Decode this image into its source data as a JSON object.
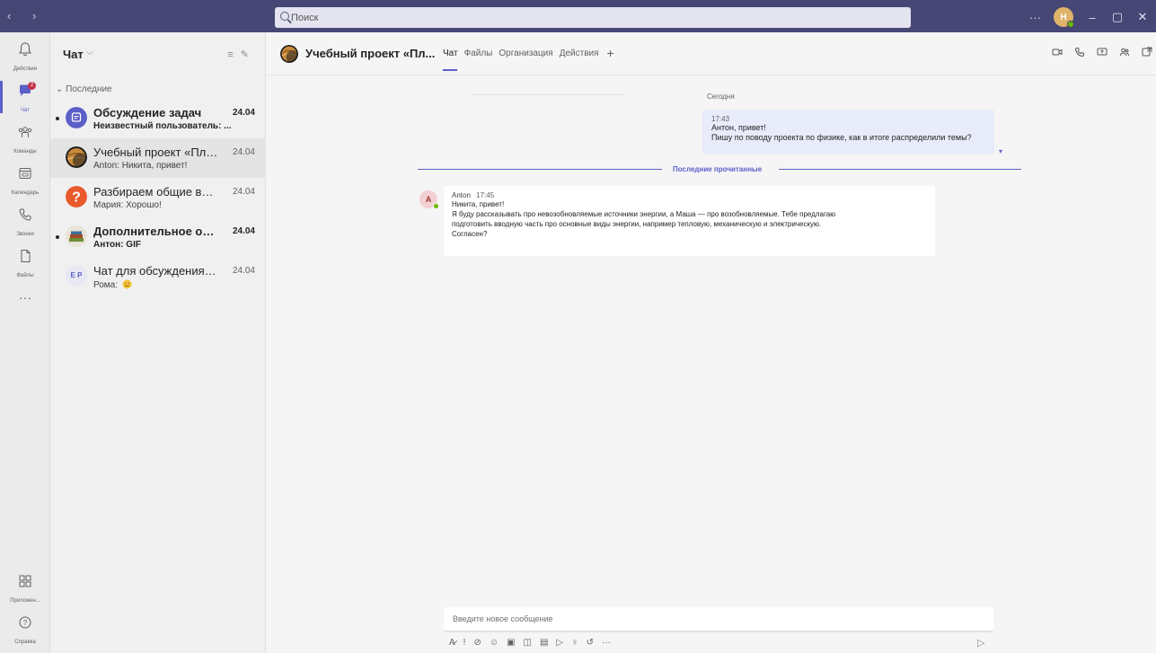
{
  "titlebar": {
    "nav": "‹ ›",
    "search_placeholder": "Поиск",
    "more": "···",
    "avatar_initials": "Н",
    "minimize": "–",
    "maximize": "▢",
    "close": "✕"
  },
  "rail": {
    "activity": "Действия",
    "chat": "Чат",
    "chat_badge": "2",
    "teams": "Команды",
    "calendar": "Календарь",
    "calls": "Звонки",
    "files": "Файлы",
    "more": "···",
    "apps": "Приложен...",
    "help": "Справка"
  },
  "chatlist": {
    "title": "Чат",
    "section": "Последние",
    "items": [
      {
        "name": "Обсуждение задач",
        "date": "24.04",
        "preview": "Неизвестный пользователь: ...",
        "unread": true
      },
      {
        "name": "Учебный проект «Плане...",
        "date": "24.04",
        "preview": "Anton: Никита, привет!",
        "unread": false
      },
      {
        "name": "Разбираем общие вопр...",
        "date": "24.04",
        "preview": "Мария: Хорошо!",
        "unread": false
      },
      {
        "name": "Дополнительное обра...",
        "date": "24.04",
        "preview": "Антон: GIF",
        "unread": true
      },
      {
        "name": "Чат для обсуждения зад...",
        "date": "24.04",
        "preview": "Рома:",
        "unread": false,
        "avatar_initials": "E P"
      }
    ]
  },
  "conversation": {
    "title": "Учебный проект «Пл...",
    "tabs": [
      "Чат",
      "Файлы",
      "Организация",
      "Действия"
    ],
    "day_separator": "Сегодня",
    "my_message": {
      "time": "17:43",
      "line1": "Антон, привет!",
      "line2": "Пишу по поводу проекта по физике, как в итоге распределили темы?"
    },
    "unread_divider": "Последние прочитанные",
    "other_message": {
      "author": "Anton",
      "time": "17:45",
      "avatar_initials": "A",
      "line1": "Никита, привет!",
      "line2": "Я буду рассказывать про невозобновляемые источники энергии, а Маша — про возобновляемые. Тебе предлагаю",
      "line3": "подготовить вводную часть про основные виды энергии, например тепловую, механическую и электрическую.",
      "line4": "Согласен?"
    },
    "composer_placeholder": "Введите новое сообщение"
  },
  "colors": {
    "titlebar": "#464775",
    "accent": "#5b5fc7",
    "my_bubble": "#e8ebfa"
  }
}
